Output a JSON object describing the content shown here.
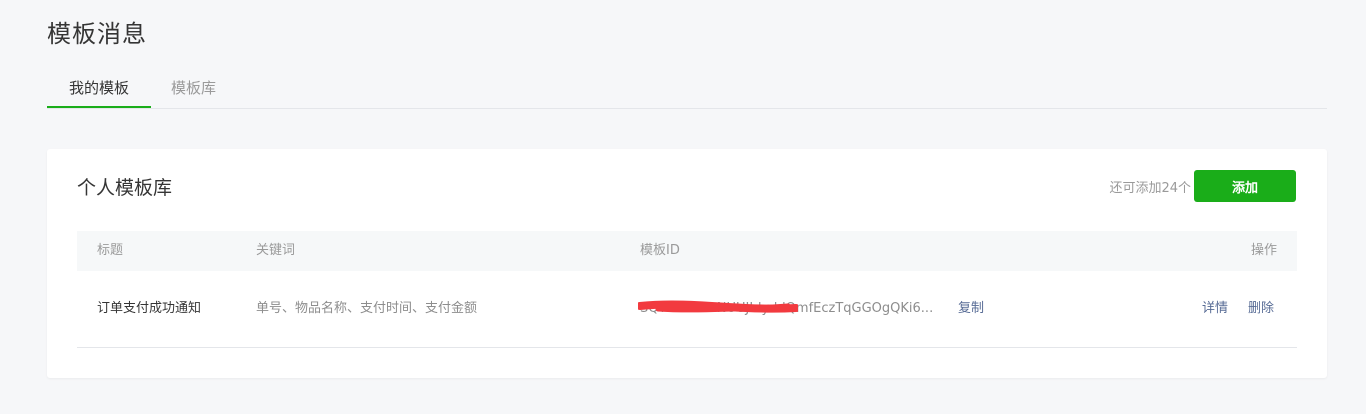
{
  "page": {
    "title": "模板消息"
  },
  "tabs": [
    {
      "label": "我的模板",
      "active": true
    },
    {
      "label": "模板库",
      "active": false
    }
  ],
  "card": {
    "title": "个人模板库",
    "remaining_text": "还可添加24个",
    "add_button_label": "添加"
  },
  "table": {
    "headers": {
      "title": "标题",
      "keywords": "关键词",
      "template_id": "模板ID",
      "operations": "操作"
    },
    "rows": [
      {
        "title": "订单支付成功通知",
        "keywords": "单号、物品名称、支付时间、支付金额",
        "template_id": "SQTRdvA9nNUUJIdyddQmfEczTqGGOgQKi6...",
        "copy_label": "复制",
        "detail_label": "详情",
        "delete_label": "删除"
      }
    ]
  },
  "colors": {
    "accent_green": "#1aad19",
    "link_blue": "#576b95",
    "redaction_red": "#f23a3f"
  }
}
